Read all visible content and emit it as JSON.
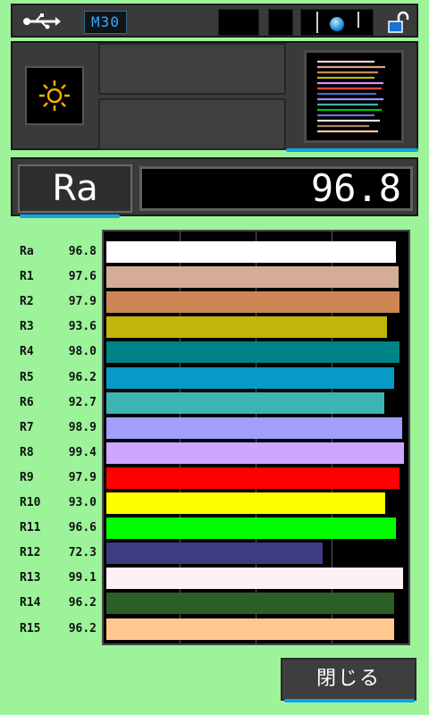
{
  "status_bar": {
    "mode_label": "M30",
    "icons": [
      "usb-icon",
      "battery-icon",
      "unlocked-padlock-icon"
    ]
  },
  "controls": {
    "mode_icon": "sun-icon",
    "spectrum_icon": "spectrum-thumbnail-icon"
  },
  "ra": {
    "label": "Ra",
    "value": "96.8"
  },
  "cri": {
    "rows": [
      {
        "label": "Ra",
        "value": "96.8",
        "color": "#ffffff"
      },
      {
        "label": "R1",
        "value": "97.6",
        "color": "#d5ad96"
      },
      {
        "label": "R2",
        "value": "97.9",
        "color": "#cd8755"
      },
      {
        "label": "R3",
        "value": "93.6",
        "color": "#c1b40b"
      },
      {
        "label": "R4",
        "value": "98.0",
        "color": "#008386"
      },
      {
        "label": "R5",
        "value": "96.2",
        "color": "#0899c8"
      },
      {
        "label": "R6",
        "value": "92.7",
        "color": "#3cb4b1"
      },
      {
        "label": "R7",
        "value": "98.9",
        "color": "#a09ffb"
      },
      {
        "label": "R8",
        "value": "99.4",
        "color": "#cda6fe"
      },
      {
        "label": "R9",
        "value": "97.9",
        "color": "#ff0000"
      },
      {
        "label": "R10",
        "value": "93.0",
        "color": "#ffff00"
      },
      {
        "label": "R11",
        "value": "96.6",
        "color": "#00ff00"
      },
      {
        "label": "R12",
        "value": "72.3",
        "color": "#3e3b80"
      },
      {
        "label": "R13",
        "value": "99.1",
        "color": "#fff0f4"
      },
      {
        "label": "R14",
        "value": "96.2",
        "color": "#2b5f26"
      },
      {
        "label": "R15",
        "value": "96.2",
        "color": "#ffc88f"
      }
    ],
    "axis_max": 100
  },
  "close_button": {
    "label": "閉じる"
  }
}
